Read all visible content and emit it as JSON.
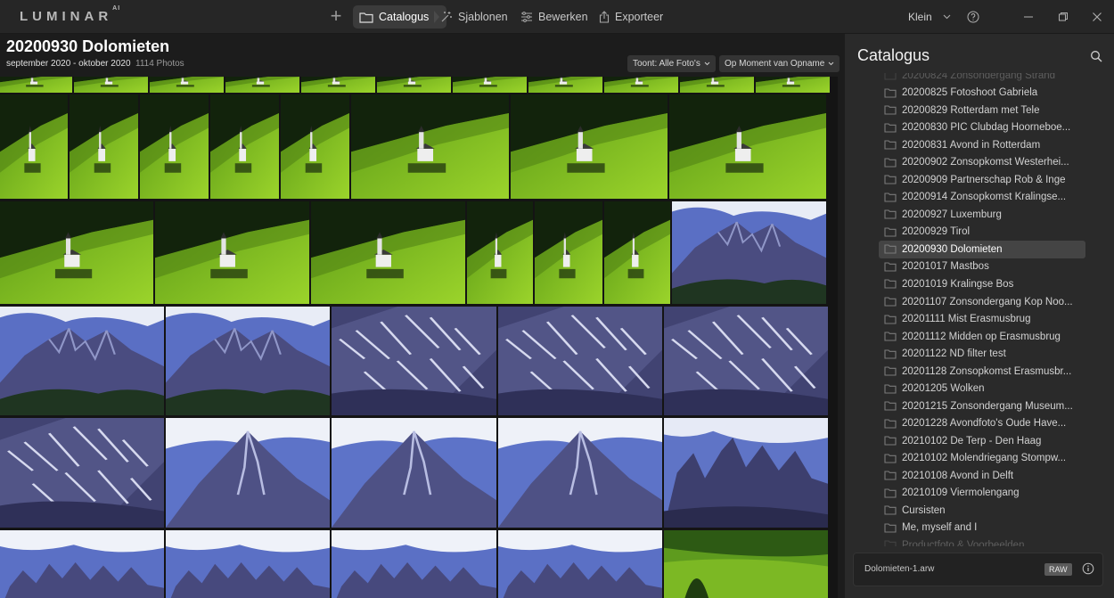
{
  "app": {
    "logo": "LUMINAR",
    "logo_suffix": "AI"
  },
  "toolbar": {
    "add_label": "+",
    "tabs": [
      {
        "label": "Catalogus",
        "icon": "folder-icon",
        "active": true
      },
      {
        "label": "Sjablonen",
        "icon": "magic-wand-icon",
        "active": false
      },
      {
        "label": "Bewerken",
        "icon": "sliders-icon",
        "active": false
      },
      {
        "label": "Exporteer",
        "icon": "export-icon",
        "active": false
      }
    ],
    "thumb_size": "Klein"
  },
  "album": {
    "title": "20200930 Dolomieten",
    "range": "september 2020 - oktober 2020",
    "count": "1114 Photos",
    "filter_label": "Toont: Alle Foto's",
    "sort_label": "Op Moment van Opname"
  },
  "panel": {
    "title": "Catalogus",
    "albums": [
      "20200824 Zonsondergang Strand",
      "20200825 Fotoshoot Gabriela",
      "20200829 Rotterdam met Tele",
      "20200830 PIC Clubdag Hoorneboe...",
      "20200831 Avond in Rotterdam",
      "20200902 Zonsopkomst Westerhei...",
      "20200909 Partnerschap Rob & Inge",
      "20200914 Zonsopkomst Kralingse...",
      "20200927 Luxemburg",
      "20200929 Tirol",
      "20200930 Dolomieten",
      "20201017 Mastbos",
      "20201019 Kralingse Bos",
      "20201107 Zonsondergang Kop Noo...",
      "20201111 Mist Erasmusbrug",
      "20201112 Midden op Erasmusbrug",
      "20201122 ND filter test",
      "20201128 Zonsopkomst Erasmusbr...",
      "20201205 Wolken",
      "20201215 Zonsondergang Museum...",
      "20201228 Avondfoto's Oude Have...",
      "20210102 De Terp - Den Haag",
      "20210102 Molendriegang Stompw...",
      "20210108 Avond in Delft",
      "20210109 Viermolengang",
      "Cursisten",
      "Me, myself and I",
      "Productfoto & Voorbeelden"
    ],
    "selected_index": 10,
    "file_name": "Dolomieten-1.arw",
    "file_badge": "RAW"
  },
  "colors": {
    "background": "#1b1b1b",
    "panel": "#2a2a2a",
    "meadow": "#7fbf1e",
    "sky": "#5a6fc4",
    "rock": "#46497c"
  },
  "photos": {
    "row1": [
      "meadow-strip",
      "meadow-strip",
      "meadow-strip",
      "meadow-strip",
      "meadow-strip",
      "meadow-strip",
      "meadow-strip",
      "meadow-strip",
      "meadow-strip",
      "meadow-strip",
      "meadow-strip"
    ],
    "row2": [
      "chapel",
      "chapel",
      "chapel",
      "chapel",
      "chapel",
      "chapel",
      "chapel",
      "chapel"
    ],
    "row3": [
      "chapel",
      "chapel",
      "chapel",
      "chapel",
      "chapel",
      "chapel",
      "mountain-sky"
    ],
    "row4": [
      "mountain-sky",
      "mountain-sky",
      "snow-slope",
      "snow-slope",
      "snow-slope"
    ],
    "row5": [
      "snow-slope",
      "peak-sky",
      "peak-sky",
      "peak-sky",
      "peaks-dark"
    ],
    "row6": [
      "peaks-sky",
      "peaks-sky",
      "peaks-sky",
      "peaks-sky",
      "meadow-tree"
    ]
  }
}
